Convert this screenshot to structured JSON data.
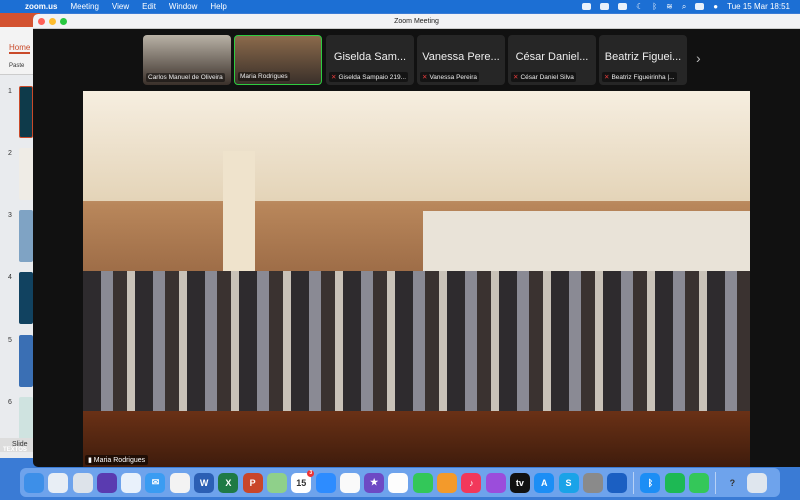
{
  "menubar": {
    "app": "zoom.us",
    "items": [
      "Meeting",
      "View",
      "Edit",
      "Window",
      "Help"
    ],
    "datetime": "Tue 15 Mar  18:51"
  },
  "powerpoint": {
    "tab": "Home",
    "paste": "Paste",
    "slides": [
      "1",
      "2",
      "3",
      "4",
      "5",
      "6"
    ],
    "footer": "Slide",
    "footer2": "TEXTOS"
  },
  "zoom": {
    "title": "Zoom Meeting",
    "participants": [
      {
        "big": "",
        "label": "Carlos Manuel de Oliveira",
        "muted": false,
        "video": true,
        "color": "#b9b2a6"
      },
      {
        "big": "",
        "label": "Maria Rodrigues",
        "muted": false,
        "video": true,
        "active": true,
        "color": "#8b6a4b"
      },
      {
        "big": "Giselda Sam...",
        "label": "Giselda Sampaio 219...",
        "muted": true
      },
      {
        "big": "Vanessa Pere...",
        "label": "Vanessa Pereira",
        "muted": true
      },
      {
        "big": "César Daniel...",
        "label": "César Daniel Silva",
        "muted": true
      },
      {
        "big": "Beatriz Figuei...",
        "label": "Beatriz Figueirinha |...",
        "muted": true
      }
    ],
    "next": "›",
    "speaker_label": "Maria Rodrigues"
  },
  "dock": [
    {
      "name": "finder",
      "bg": "#3d8fe8",
      "t": ""
    },
    {
      "name": "screenshot",
      "bg": "#e8eef5",
      "t": ""
    },
    {
      "name": "launchpad",
      "bg": "#dde3ea",
      "t": ""
    },
    {
      "name": "siri",
      "bg": "#5a3bb0",
      "t": ""
    },
    {
      "name": "safari",
      "bg": "#e9f1fb",
      "t": ""
    },
    {
      "name": "mail",
      "bg": "#3a9cf2",
      "t": "✉"
    },
    {
      "name": "chrome",
      "bg": "#f3f3f3",
      "t": ""
    },
    {
      "name": "word",
      "bg": "#2b5fb4",
      "t": "W"
    },
    {
      "name": "excel",
      "bg": "#1f7a45",
      "t": "X"
    },
    {
      "name": "powerpoint",
      "bg": "#c9462a",
      "t": "P"
    },
    {
      "name": "maps",
      "bg": "#8fd08a",
      "t": ""
    },
    {
      "name": "calendar",
      "bg": "#ffffff",
      "t": "15",
      "badge": "3"
    },
    {
      "name": "zoom",
      "bg": "#2d8cff",
      "t": ""
    },
    {
      "name": "reminders",
      "bg": "#fafafa",
      "t": ""
    },
    {
      "name": "imovie",
      "bg": "#6d4ac4",
      "t": "★"
    },
    {
      "name": "photos",
      "bg": "#fdfdfd",
      "t": ""
    },
    {
      "name": "facetime",
      "bg": "#33c759",
      "t": ""
    },
    {
      "name": "pages",
      "bg": "#f39a2b",
      "t": ""
    },
    {
      "name": "music",
      "bg": "#f2385a",
      "t": "♪"
    },
    {
      "name": "podcasts",
      "bg": "#9b4ddb",
      "t": ""
    },
    {
      "name": "apple-tv",
      "bg": "#111",
      "t": "tv"
    },
    {
      "name": "app-store",
      "bg": "#1c8ef5",
      "t": "A"
    },
    {
      "name": "skype",
      "bg": "#1aa3e8",
      "t": "S"
    },
    {
      "name": "system-preferences",
      "bg": "#8a8a8a",
      "t": ""
    },
    {
      "name": "app",
      "bg": "#1b5fc2",
      "t": ""
    },
    {
      "sep": true
    },
    {
      "name": "bluetooth",
      "bg": "#1c8ef5",
      "t": "ᛒ"
    },
    {
      "name": "spotify",
      "bg": "#1db954",
      "t": ""
    },
    {
      "name": "messages",
      "bg": "#34c759",
      "t": ""
    },
    {
      "sep": true
    },
    {
      "name": "help",
      "bg": "transparent",
      "t": "?"
    },
    {
      "name": "trash",
      "bg": "#dfe6ee",
      "t": ""
    }
  ]
}
